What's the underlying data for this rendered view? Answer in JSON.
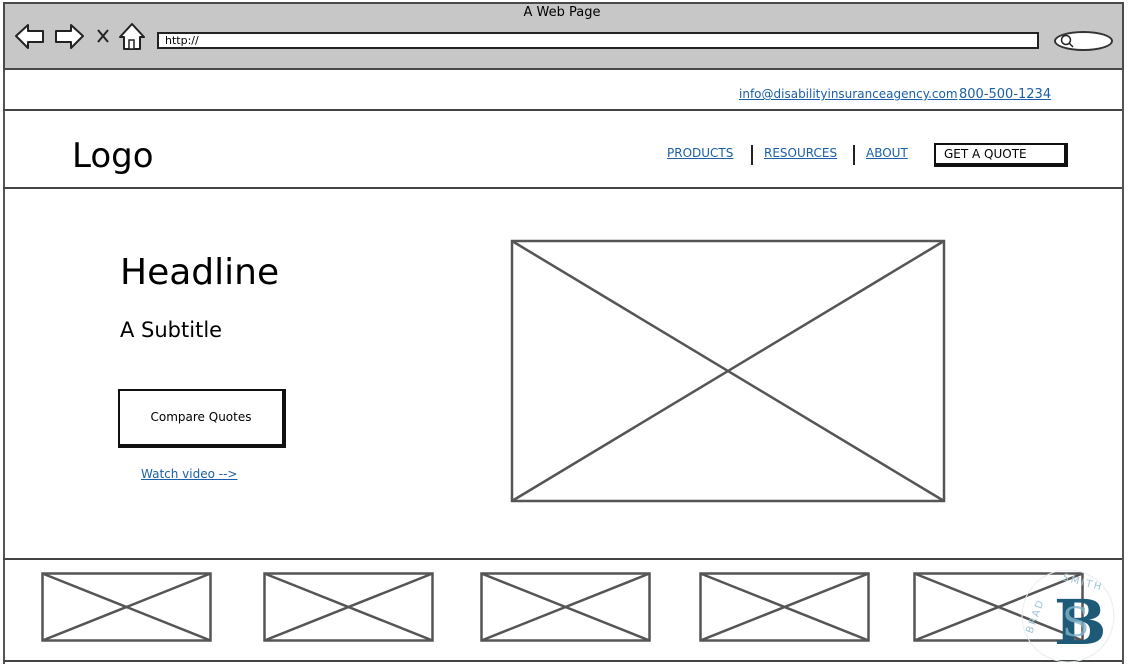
{
  "browser": {
    "title": "A Web Page",
    "url": "http://",
    "icons": [
      "back-arrow-icon",
      "forward-arrow-icon",
      "close-icon",
      "home-icon",
      "search-icon"
    ]
  },
  "topbar": {
    "email": "info@disabilityinsuranceagency.com",
    "phone": "800-500-1234"
  },
  "header": {
    "logo": "Logo",
    "nav": [
      "PRODUCTS",
      "RESOURCES",
      "ABOUT"
    ],
    "cta": "GET A QUOTE"
  },
  "hero": {
    "headline": "Headline",
    "subtitle": "A Subtitle",
    "button": "Compare Quotes",
    "video_link": "Watch video -->"
  },
  "watermark": {
    "text": "BRAD SMITH",
    "monogram": "BS",
    "color": "#1e5a78"
  }
}
